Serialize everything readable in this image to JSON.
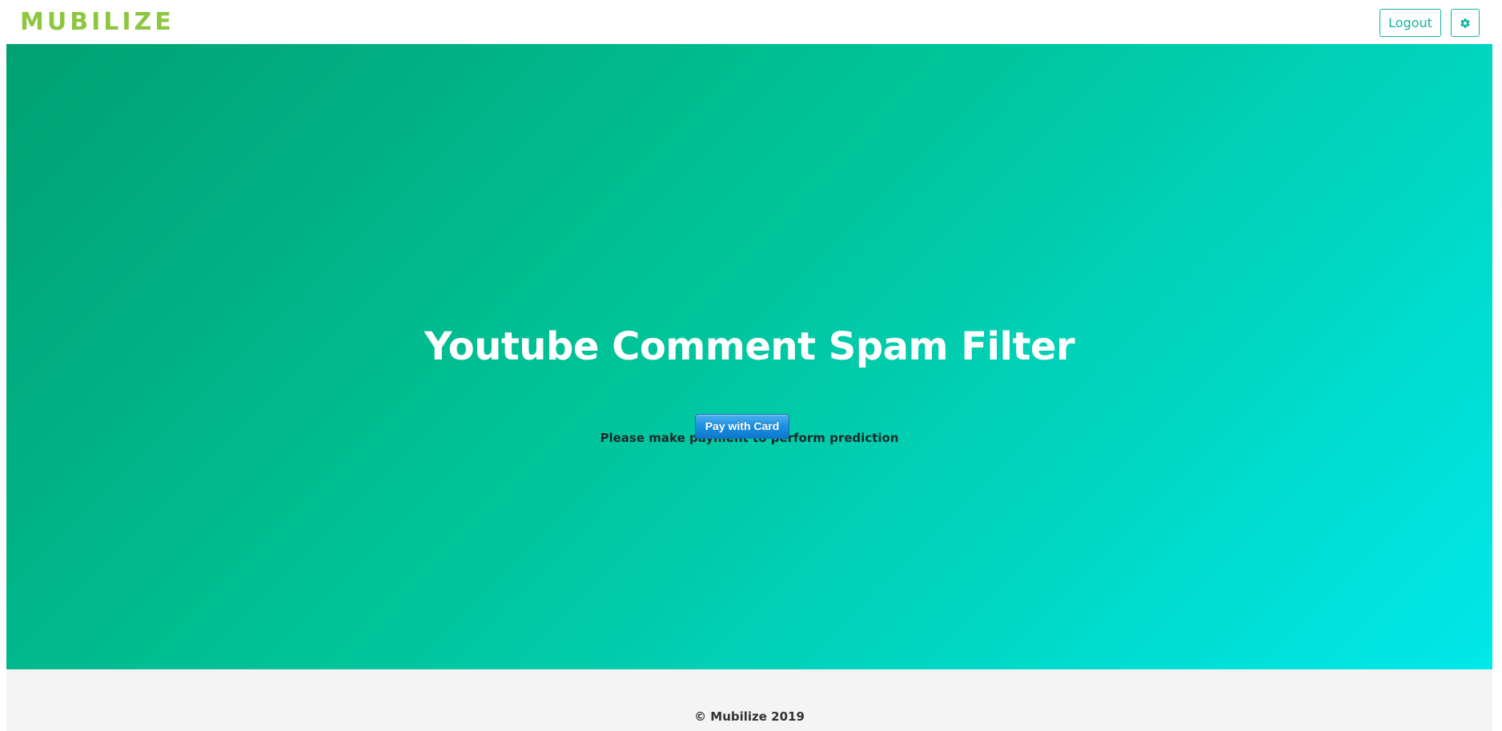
{
  "header": {
    "logo_text": "MUBILIZE",
    "logout_label": "Logout",
    "settings_icon": "gear-icon"
  },
  "hero": {
    "title": "Youtube Comment Spam Filter",
    "message": "Please make payment to perform prediction",
    "pay_button_label": "Pay with Card"
  },
  "footer": {
    "copyright": "© Mubilize 2019"
  },
  "colors": {
    "brand_green": "#8dc63f",
    "accent_teal": "#14b5a0",
    "gradient_start": "#00a071",
    "gradient_end": "#00e8ea",
    "pay_button_blue": "#1a8fe0",
    "footer_bg": "#f4f4f4"
  }
}
